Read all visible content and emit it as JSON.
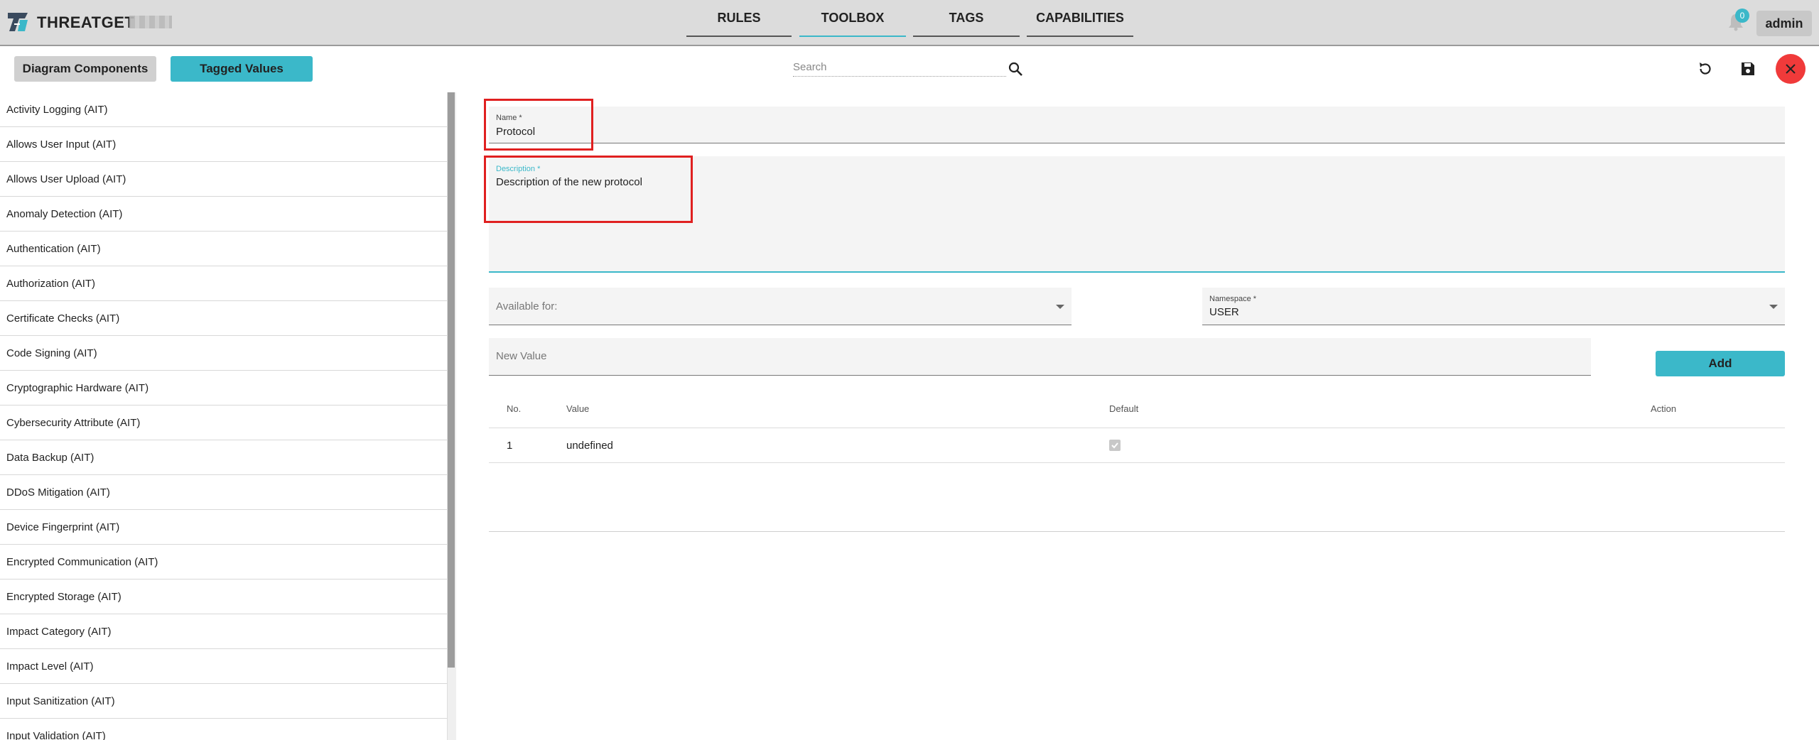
{
  "app": {
    "brand": "THREATGET"
  },
  "nav": {
    "tabs": [
      {
        "label": "RULES"
      },
      {
        "label": "TOOLBOX"
      },
      {
        "label": "TAGS"
      },
      {
        "label": "CAPABILITIES"
      }
    ],
    "notification_count": "0",
    "user": "admin"
  },
  "toolbar": {
    "diagram_components_label": "Diagram Components",
    "tagged_values_label": "Tagged Values",
    "search_placeholder": "Search"
  },
  "sidebar": {
    "items": [
      {
        "label": "Activity Logging (AIT)"
      },
      {
        "label": "Allows User Input (AIT)"
      },
      {
        "label": "Allows User Upload (AIT)"
      },
      {
        "label": "Anomaly Detection (AIT)"
      },
      {
        "label": "Authentication (AIT)"
      },
      {
        "label": "Authorization (AIT)"
      },
      {
        "label": "Certificate Checks (AIT)"
      },
      {
        "label": "Code Signing (AIT)"
      },
      {
        "label": "Cryptographic Hardware (AIT)"
      },
      {
        "label": "Cybersecurity Attribute (AIT)"
      },
      {
        "label": "Data Backup (AIT)"
      },
      {
        "label": "DDoS Mitigation (AIT)"
      },
      {
        "label": "Device Fingerprint (AIT)"
      },
      {
        "label": "Encrypted Communication (AIT)"
      },
      {
        "label": "Encrypted Storage (AIT)"
      },
      {
        "label": "Impact Category (AIT)"
      },
      {
        "label": "Impact Level (AIT)"
      },
      {
        "label": "Input Sanitization (AIT)"
      },
      {
        "label": "Input Validation (AIT)"
      }
    ]
  },
  "form": {
    "name": {
      "label": "Name *",
      "value": "Protocol"
    },
    "description": {
      "label": "Description *",
      "value": "Description of the new protocol"
    },
    "available_for": {
      "placeholder": "Available for:"
    },
    "namespace": {
      "label": "Namespace *",
      "value": "USER"
    },
    "new_value": {
      "placeholder": "New Value"
    },
    "add_label": "Add"
  },
  "table": {
    "headers": {
      "no": "No.",
      "value": "Value",
      "default": "Default",
      "action": "Action"
    },
    "rows": [
      {
        "no": "1",
        "value": "undefined",
        "default": true
      }
    ]
  },
  "colors": {
    "accent": "#3bb8c9",
    "close": "#f03a3a",
    "highlight": "#e02020"
  }
}
